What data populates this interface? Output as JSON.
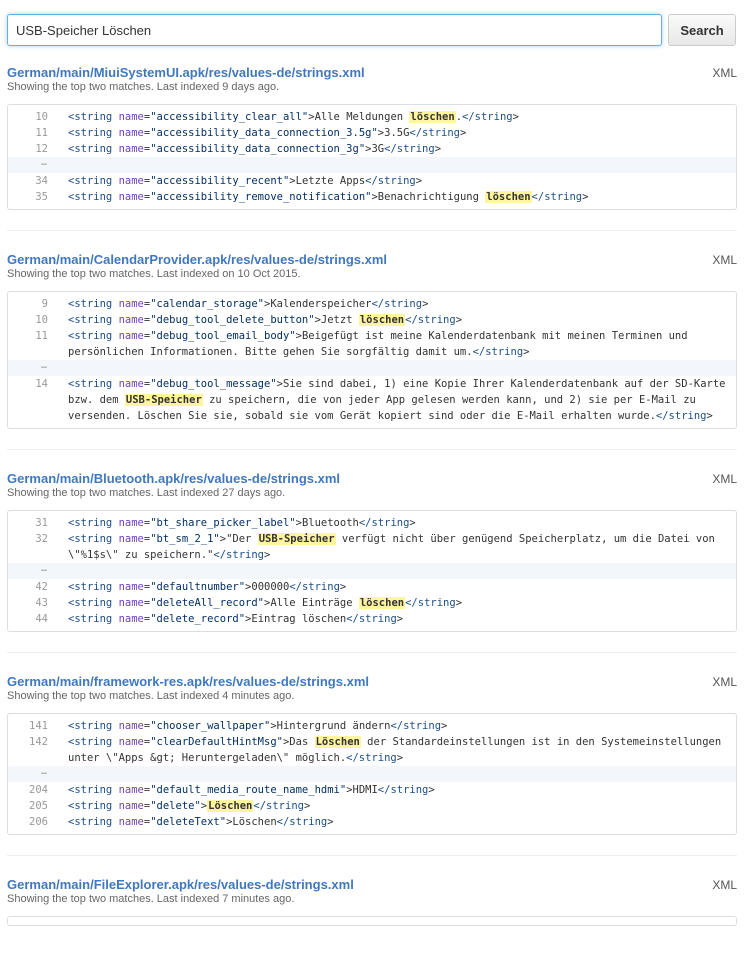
{
  "search": {
    "value": "USB-Speicher Löschen",
    "button_label": "Search"
  },
  "results": [
    {
      "path": "German/main/MiuiSystemUI.apk/res/values-de/strings.xml",
      "meta": "Showing the top two matches. Last indexed 9 days ago.",
      "lang": "XML",
      "lines": [
        {
          "n": "10",
          "html": "&lt;string name=\"accessibility_clear_all\"&gt;Alle Meldungen <mark>löschen</mark>.&lt;/string&gt;"
        },
        {
          "n": "11",
          "html": "&lt;string name=\"accessibility_data_connection_3.5g\"&gt;3.5G&lt;/string&gt;"
        },
        {
          "n": "12",
          "html": "&lt;string name=\"accessibility_data_connection_3g\"&gt;3G&lt;/string&gt;"
        },
        {
          "sep": "…"
        },
        {
          "n": "34",
          "html": "&lt;string name=\"accessibility_recent\"&gt;Letzte Apps&lt;/string&gt;"
        },
        {
          "n": "35",
          "html": "&lt;string name=\"accessibility_remove_notification\"&gt;Benachrichtigung <mark>löschen</mark>&lt;/string&gt;"
        }
      ]
    },
    {
      "path": "German/main/CalendarProvider.apk/res/values-de/strings.xml",
      "meta": "Showing the top two matches. Last indexed on 10 Oct 2015.",
      "lang": "XML",
      "lines": [
        {
          "n": "9",
          "html": "&lt;string name=\"calendar_storage\"&gt;Kalenderspeicher&lt;/string&gt;"
        },
        {
          "n": "10",
          "html": "&lt;string name=\"debug_tool_delete_button\"&gt;Jetzt <mark>löschen</mark>&lt;/string&gt;"
        },
        {
          "n": "11",
          "html": "&lt;string name=\"debug_tool_email_body\"&gt;Beigefügt ist meine Kalenderdatenbank mit meinen Terminen und persönlichen Informationen. Bitte gehen Sie sorgfältig damit um.&lt;/string&gt;"
        },
        {
          "sep": "…"
        },
        {
          "n": "14",
          "html": "&lt;string name=\"debug_tool_message\"&gt;Sie sind dabei, 1) eine Kopie Ihrer Kalenderdatenbank auf der SD-Karte bzw. dem <mark>USB-Speicher</mark> zu speichern, die von jeder App gelesen werden kann, und 2) sie per E-Mail zu versenden. Löschen Sie sie, sobald sie vom Gerät kopiert sind oder die E-Mail erhalten wurde.&lt;/string&gt;"
        }
      ]
    },
    {
      "path": "German/main/Bluetooth.apk/res/values-de/strings.xml",
      "meta": "Showing the top two matches. Last indexed 27 days ago.",
      "lang": "XML",
      "lines": [
        {
          "n": "31",
          "html": "&lt;string name=\"bt_share_picker_label\"&gt;Bluetooth&lt;/string&gt;"
        },
        {
          "n": "32",
          "html": "&lt;string name=\"bt_sm_2_1\"&gt;\"Der <mark>USB-Speicher</mark> verfügt nicht über genügend Speicherplatz, um die Datei von \\\"%1$s\\\" zu speichern.\"&lt;/string&gt;"
        },
        {
          "sep": "…"
        },
        {
          "n": "42",
          "html": "&lt;string name=\"defaultnumber\"&gt;000000&lt;/string&gt;"
        },
        {
          "n": "43",
          "html": "&lt;string name=\"deleteAll_record\"&gt;Alle Einträge <mark>löschen</mark>&lt;/string&gt;"
        },
        {
          "n": "44",
          "html": "&lt;string name=\"delete_record\"&gt;Eintrag löschen&lt;/string&gt;"
        }
      ]
    },
    {
      "path": "German/main/framework-res.apk/res/values-de/strings.xml",
      "meta": "Showing the top two matches. Last indexed 4 minutes ago.",
      "lang": "XML",
      "lines": [
        {
          "n": "141",
          "html": "&lt;string name=\"chooser_wallpaper\"&gt;Hintergrund ändern&lt;/string&gt;"
        },
        {
          "n": "142",
          "html": "&lt;string name=\"clearDefaultHintMsg\"&gt;Das <mark>Löschen</mark> der Standardeinstellungen ist in den Systemeinstellungen unter \\\"Apps &amp;gt; Heruntergeladen\\\" möglich.&lt;/string&gt;"
        },
        {
          "sep": "…"
        },
        {
          "n": "204",
          "html": "&lt;string name=\"default_media_route_name_hdmi\"&gt;HDMI&lt;/string&gt;"
        },
        {
          "n": "205",
          "html": "&lt;string name=\"delete\"&gt;<mark>Löschen</mark>&lt;/string&gt;"
        },
        {
          "n": "206",
          "html": "&lt;string name=\"deleteText\"&gt;Löschen&lt;/string&gt;"
        }
      ]
    },
    {
      "path": "German/main/FileExplorer.apk/res/values-de/strings.xml",
      "meta": "Showing the top two matches. Last indexed 7 minutes ago.",
      "lang": "XML",
      "lines": []
    }
  ]
}
